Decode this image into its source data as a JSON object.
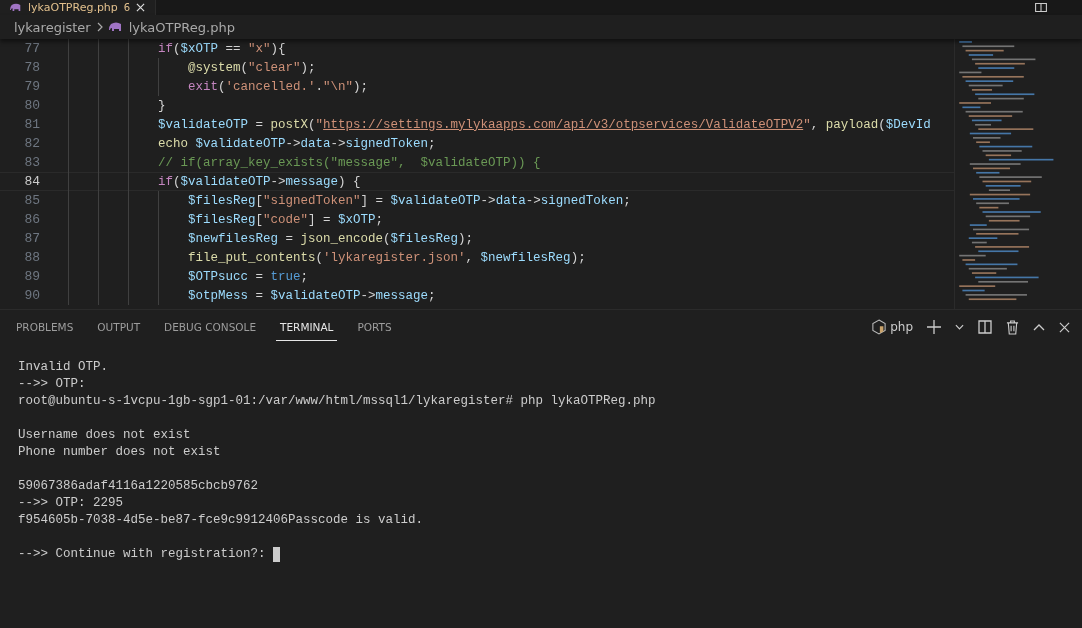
{
  "editor_tab": {
    "label": "lykaOTPReg.php",
    "badge": "6"
  },
  "breadcrumb": [
    "lykaregister",
    "lykaOTPReg.php"
  ],
  "code_lines": [
    {
      "number": "77",
      "current": false,
      "tokens": [
        {
          "kind": "kw",
          "text": "            if"
        },
        {
          "kind": "plain",
          "text": "("
        },
        {
          "kind": "var",
          "text": "$xOTP"
        },
        {
          "kind": "plain",
          "text": " == "
        },
        {
          "kind": "str",
          "text": "\"x\""
        },
        {
          "kind": "plain",
          "text": "){"
        }
      ]
    },
    {
      "number": "78",
      "current": false,
      "tokens": [
        {
          "kind": "fn",
          "text": "                @system"
        },
        {
          "kind": "plain",
          "text": "("
        },
        {
          "kind": "str",
          "text": "\"clear\""
        },
        {
          "kind": "plain",
          "text": ");"
        }
      ]
    },
    {
      "number": "79",
      "current": false,
      "tokens": [
        {
          "kind": "kw",
          "text": "                exit"
        },
        {
          "kind": "plain",
          "text": "("
        },
        {
          "kind": "str",
          "text": "'cancelled.'"
        },
        {
          "kind": "plain",
          "text": "."
        },
        {
          "kind": "str",
          "text": "\"\\n\""
        },
        {
          "kind": "plain",
          "text": ");"
        }
      ]
    },
    {
      "number": "80",
      "current": false,
      "tokens": [
        {
          "kind": "plain",
          "text": "            }"
        }
      ]
    },
    {
      "number": "81",
      "current": false,
      "tokens": [
        {
          "kind": "var",
          "text": "            $validateOTP"
        },
        {
          "kind": "plain",
          "text": " = "
        },
        {
          "kind": "fn",
          "text": "postX"
        },
        {
          "kind": "plain",
          "text": "("
        },
        {
          "kind": "str",
          "text": "\""
        },
        {
          "kind": "link",
          "text": "https://settings.mylykaapps.com/api/v3/otpservices/ValidateOTPV2"
        },
        {
          "kind": "str",
          "text": "\""
        },
        {
          "kind": "plain",
          "text": ", "
        },
        {
          "kind": "fn",
          "text": "payload"
        },
        {
          "kind": "plain",
          "text": "("
        },
        {
          "kind": "var",
          "text": "$DevId"
        }
      ]
    },
    {
      "number": "82",
      "current": false,
      "tokens": [
        {
          "kind": "fn",
          "text": "            echo "
        },
        {
          "kind": "var",
          "text": "$validateOTP"
        },
        {
          "kind": "plain",
          "text": "->"
        },
        {
          "kind": "var",
          "text": "data"
        },
        {
          "kind": "plain",
          "text": "->"
        },
        {
          "kind": "var",
          "text": "signedToken"
        },
        {
          "kind": "plain",
          "text": ";"
        }
      ]
    },
    {
      "number": "83",
      "current": false,
      "tokens": [
        {
          "kind": "comment",
          "text": "            // if(array_key_exists(\"message\",  $validateOTP)) {"
        }
      ]
    },
    {
      "number": "84",
      "current": true,
      "tokens": [
        {
          "kind": "kw",
          "text": "            if"
        },
        {
          "kind": "plain",
          "text": "("
        },
        {
          "kind": "var",
          "text": "$validateOTP"
        },
        {
          "kind": "plain",
          "text": "->"
        },
        {
          "kind": "var",
          "text": "message"
        },
        {
          "kind": "plain",
          "text": ") {"
        }
      ]
    },
    {
      "number": "85",
      "current": false,
      "tokens": [
        {
          "kind": "var",
          "text": "                $filesReg"
        },
        {
          "kind": "plain",
          "text": "["
        },
        {
          "kind": "str",
          "text": "\"signedToken\""
        },
        {
          "kind": "plain",
          "text": "] = "
        },
        {
          "kind": "var",
          "text": "$validateOTP"
        },
        {
          "kind": "plain",
          "text": "->"
        },
        {
          "kind": "var",
          "text": "data"
        },
        {
          "kind": "plain",
          "text": "->"
        },
        {
          "kind": "var",
          "text": "signedToken"
        },
        {
          "kind": "plain",
          "text": ";"
        }
      ]
    },
    {
      "number": "86",
      "current": false,
      "tokens": [
        {
          "kind": "var",
          "text": "                $filesReg"
        },
        {
          "kind": "plain",
          "text": "["
        },
        {
          "kind": "str",
          "text": "\"code\""
        },
        {
          "kind": "plain",
          "text": "] = "
        },
        {
          "kind": "var",
          "text": "$xOTP"
        },
        {
          "kind": "plain",
          "text": ";"
        }
      ]
    },
    {
      "number": "87",
      "current": false,
      "tokens": [
        {
          "kind": "var",
          "text": "                $newfilesReg"
        },
        {
          "kind": "plain",
          "text": " = "
        },
        {
          "kind": "fn",
          "text": "json_encode"
        },
        {
          "kind": "plain",
          "text": "("
        },
        {
          "kind": "var",
          "text": "$filesReg"
        },
        {
          "kind": "plain",
          "text": ");"
        }
      ]
    },
    {
      "number": "88",
      "current": false,
      "tokens": [
        {
          "kind": "fn",
          "text": "                file_put_contents"
        },
        {
          "kind": "plain",
          "text": "("
        },
        {
          "kind": "str",
          "text": "'lykaregister.json'"
        },
        {
          "kind": "plain",
          "text": ", "
        },
        {
          "kind": "var",
          "text": "$newfilesReg"
        },
        {
          "kind": "plain",
          "text": ");"
        }
      ]
    },
    {
      "number": "89",
      "current": false,
      "tokens": [
        {
          "kind": "var",
          "text": "                $OTPsucc"
        },
        {
          "kind": "plain",
          "text": " = "
        },
        {
          "kind": "const",
          "text": "true"
        },
        {
          "kind": "plain",
          "text": ";"
        }
      ]
    },
    {
      "number": "90",
      "current": false,
      "tokens": [
        {
          "kind": "var",
          "text": "                $otpMess"
        },
        {
          "kind": "plain",
          "text": " = "
        },
        {
          "kind": "var",
          "text": "$validateOTP"
        },
        {
          "kind": "plain",
          "text": "->"
        },
        {
          "kind": "var",
          "text": "message"
        },
        {
          "kind": "plain",
          "text": ";"
        }
      ]
    }
  ],
  "panel_tabs": [
    {
      "label": "PROBLEMS",
      "selected": false
    },
    {
      "label": "OUTPUT",
      "selected": false
    },
    {
      "label": "DEBUG CONSOLE",
      "selected": false
    },
    {
      "label": "TERMINAL",
      "selected": true
    },
    {
      "label": "PORTS",
      "selected": false
    }
  ],
  "terminal_profile": "php",
  "terminal_blocks": [
    [
      "Invalid OTP.",
      "-->> OTP:",
      "root@ubuntu-s-1vcpu-1gb-sgp1-01:/var/www/html/mssql1/lykaregister# php lykaOTPReg.php"
    ],
    [
      "Username does not exist",
      "Phone number does not exist"
    ],
    [
      "59067386adaf4116a1220585cbcb9762",
      "-->> OTP: 2295",
      "f954605b-7038-4d5e-be87-fce9c9912406Passcode is valid."
    ],
    [
      "-->> Continue with registration?:"
    ]
  ]
}
